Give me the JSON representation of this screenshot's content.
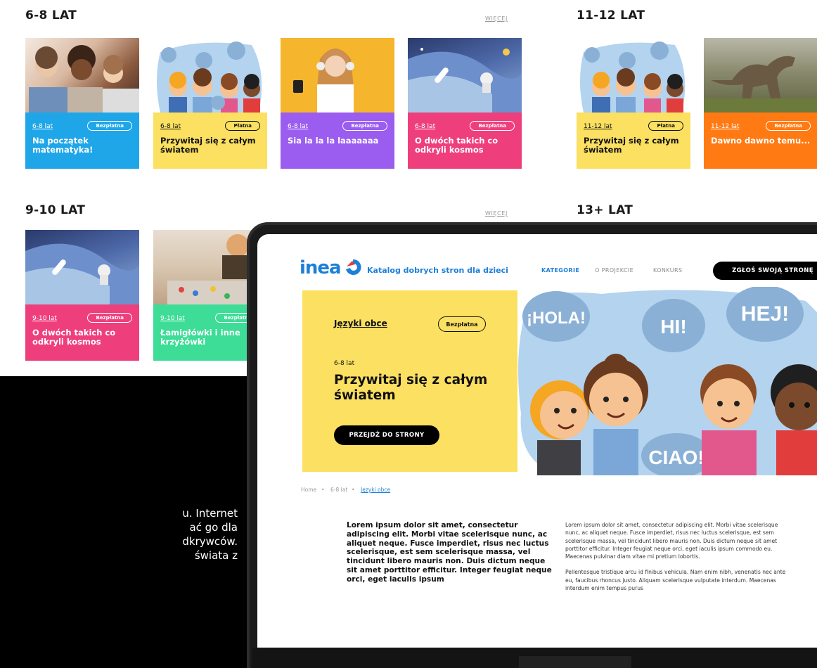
{
  "catalog": {
    "sections": [
      {
        "title": "6-8 LAT",
        "more": "WIĘCEJ"
      },
      {
        "title": "11-12 LAT"
      },
      {
        "title": "9-10 LAT",
        "more": "WIĘCEJ"
      },
      {
        "title": "13+ LAT"
      }
    ],
    "cards": [
      {
        "age": "6-8 lat",
        "badge": "Bezpłatna",
        "title": "Na początek matematyka!",
        "color": "#1fa6e8"
      },
      {
        "age": "6-8 lat",
        "badge": "Płatna",
        "title": "Przywitaj się z całym światem",
        "color": "#fbe061"
      },
      {
        "age": "6-8 lat",
        "badge": "Bezpłatna",
        "title": "Sia la la la laaaaaaa",
        "color": "#9b5cf0"
      },
      {
        "age": "6-8 lat",
        "badge": "Bezpłatna",
        "title": "O dwóch takich co odkryli kosmos",
        "color": "#ee3f7c"
      },
      {
        "age": "11-12 lat",
        "badge": "Płatna",
        "title": "Przywitaj się z całym światem",
        "color": "#fbe061"
      },
      {
        "age": "11-12 lat",
        "badge": "Bezpłatna",
        "title": "Dawno dawno temu...",
        "color": "#ff7a12"
      },
      {
        "age": "9-10 lat",
        "badge": "Bezpłatna",
        "title": "O dwóch takich co odkryli kosmos",
        "color": "#ee3f7c"
      },
      {
        "age": "9-10 lat",
        "badge": "Bezpłatna",
        "title": "Łamigłówki i inne krzyżówki",
        "color": "#3ddc97"
      }
    ]
  },
  "site": {
    "logo": "inea",
    "tagline": "Katalog dobrych stron dla dzieci",
    "nav": [
      "KATEGORIE",
      "O PROJEKCIE",
      "KONKURS"
    ],
    "cta": "ZGŁOŚ SWOJĄ STRONĘ",
    "hero": {
      "category": "Języki obce",
      "badge": "Bezpłatna",
      "age": "6-8 lat",
      "title": "Przywitaj się z całym światem",
      "button": "PRZEJDŹ DO STRONY",
      "bubbles": [
        "¡HOLA!",
        "HI!",
        "HEJ!",
        "CIAO!",
        "¡HOLA!",
        "HI!",
        "HEJ!",
        "CIAO!"
      ]
    },
    "breadcrumb": [
      "Home",
      "6-8 lat",
      "Języki obce"
    ],
    "lead": "Lorem ipsum dolor sit amet, consectetur adipiscing elit. Morbi vitae scelerisque nunc, ac aliquet neque. Fusce imperdiet, risus nec luctus scelerisque, est sem scelerisque massa, vel tincidunt libero mauris non. Duis dictum neque sit amet porttitor efficitur. Integer feugiat neque orci, eget iaculis ipsum",
    "body_p1": "Lorem ipsum dolor sit amet, consectetur adipiscing elit. Morbi vitae scelerisque nunc, ac aliquet neque. Fusce imperdiet, risus nec luctus scelerisque, est sem scelerisque massa, vel tincidunt libero mauris non. Duis dictum neque sit amet porttitor efficitur. Integer feugiat neque orci, eget iaculis ipsum commodo eu. Maecenas pulvinar diam vitae mi pretium lobortis.",
    "body_p2": "Pellentesque tristique arcu id finibus vehicula. Nam enim nibh, venenatis nec ante eu, faucibus rhoncus justo. Aliquam scelerisque vulputate interdum. Maecenas interdum enim tempus purus"
  },
  "fragment": {
    "lines": [
      "u. Internet",
      "ać go dla",
      "dkrywców.",
      "świata z"
    ]
  }
}
